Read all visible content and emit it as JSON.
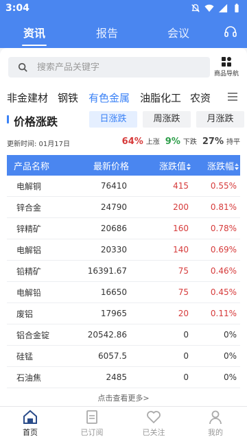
{
  "status_bar": {
    "time": "3:04"
  },
  "top_nav": {
    "tabs": [
      "资讯",
      "报告",
      "会议"
    ]
  },
  "search": {
    "placeholder": "搜索产品关键字",
    "nav_label": "商品导航"
  },
  "categories": [
    "非金建材",
    "钢铁",
    "有色金属",
    "油脂化工",
    "农资"
  ],
  "section": {
    "title": "价格涨跌",
    "periods": [
      "日涨跌",
      "周涨跌",
      "月涨跌"
    ],
    "update_time": "更新时间: 01月17日",
    "up_pct": "64%",
    "up_label": "上涨",
    "down_pct": "9%",
    "down_label": "下跌",
    "flat_pct": "27%",
    "flat_label": "持平"
  },
  "table": {
    "headers": [
      "产品名称",
      "最新价格",
      "涨跌值",
      "涨跌幅"
    ],
    "rows": [
      [
        "电解铜",
        "76410",
        "415",
        "0.55%"
      ],
      [
        "锌合金",
        "24790",
        "200",
        "0.81%"
      ],
      [
        "锌精矿",
        "20686",
        "160",
        "0.78%"
      ],
      [
        "电解铝",
        "20330",
        "140",
        "0.69%"
      ],
      [
        "铅精矿",
        "16391.67",
        "75",
        "0.46%"
      ],
      [
        "电解铅",
        "16650",
        "75",
        "0.45%"
      ],
      [
        "废铝",
        "17965",
        "20",
        "0.11%"
      ],
      [
        "铝合金锭",
        "20542.86",
        "0",
        "0%"
      ],
      [
        "硅锰",
        "6057.5",
        "0",
        "0%"
      ],
      [
        "石油焦",
        "2485",
        "0",
        "0%"
      ]
    ]
  },
  "more_link": "点击查看更多>",
  "bottom_nav": [
    "首页",
    "已订阅",
    "已关注",
    "我的"
  ],
  "colors": {
    "primary": "#4a86f0",
    "accent": "#3b82f6",
    "up": "#d63a3a",
    "down": "#2e9e4a"
  }
}
